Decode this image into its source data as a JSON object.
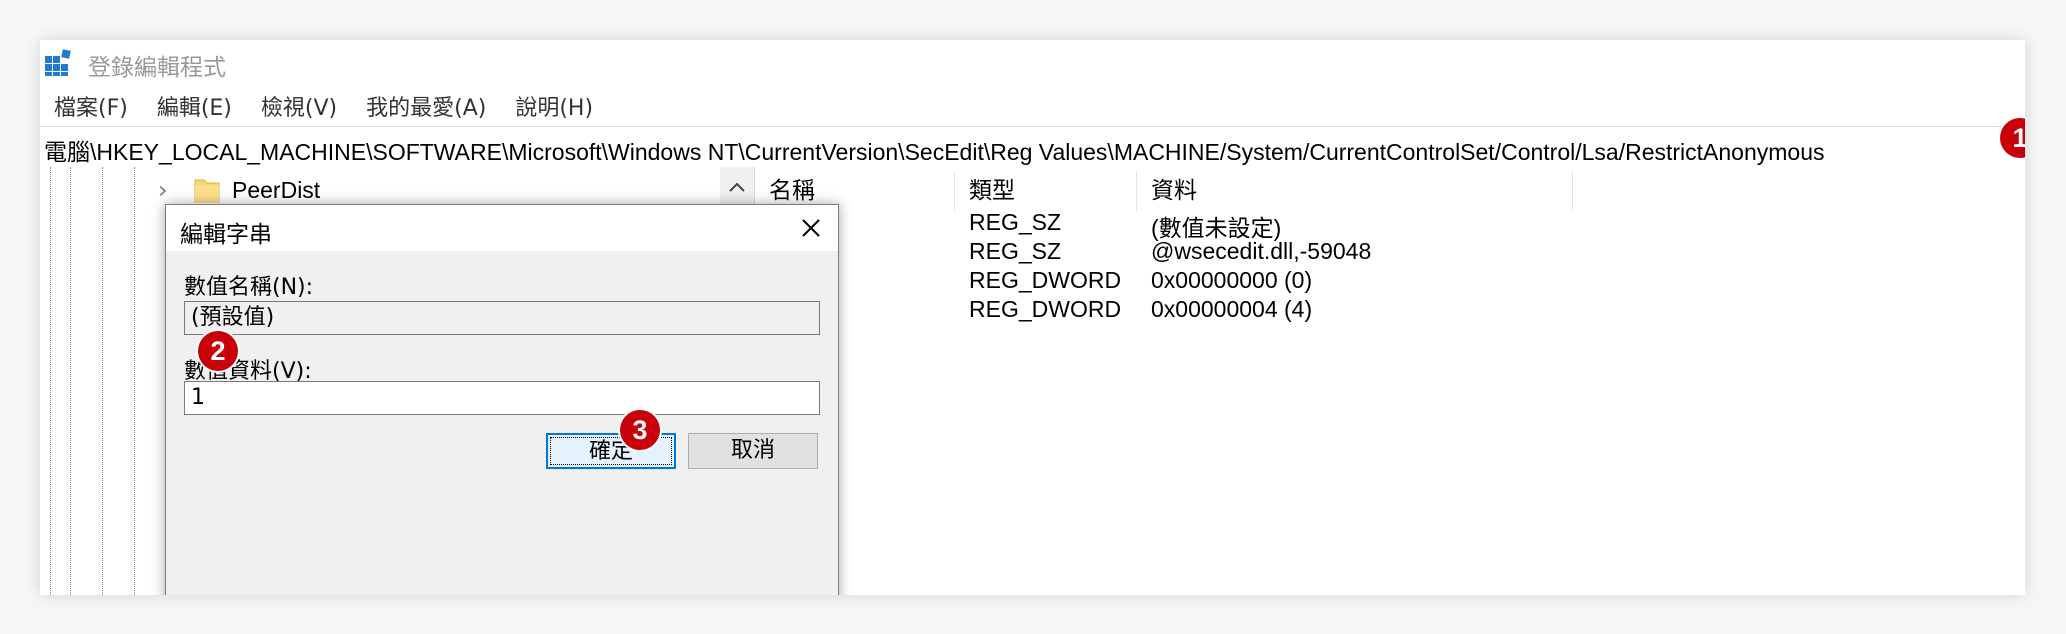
{
  "window": {
    "title": "登錄編輯程式",
    "icon": "registry-editor-icon"
  },
  "menu": [
    {
      "label": "檔案(F)"
    },
    {
      "label": "編輯(E)"
    },
    {
      "label": "檢視(V)"
    },
    {
      "label": "我的最愛(A)"
    },
    {
      "label": "說明(H)"
    }
  ],
  "address": {
    "path": "電腦\\HKEY_LOCAL_MACHINE\\SOFTWARE\\Microsoft\\Windows NT\\CurrentVersion\\SecEdit\\Reg Values\\MACHINE/System/CurrentControlSet/Control/Lsa/RestrictAnonymous"
  },
  "tree": {
    "items": [
      {
        "label": "PeerDist",
        "icon": "folder-icon",
        "expander": "chevron-right-icon"
      }
    ],
    "scroll_up_icon": "chevron-up-icon"
  },
  "values_table": {
    "columns": [
      "名稱",
      "類型",
      "資料"
    ],
    "rows": [
      {
        "type": "REG_SZ",
        "data": "(數值未設定)"
      },
      {
        "type": "REG_SZ",
        "data": "@wsecedit.dll,-59048"
      },
      {
        "type": "REG_DWORD",
        "data": "0x00000000 (0)"
      },
      {
        "type": "REG_DWORD",
        "data": "0x00000004 (4)"
      }
    ]
  },
  "dialog": {
    "title": "編輯字串",
    "close_icon": "close-icon",
    "name_label": "數值名稱(N):",
    "name_value": "(預設值)",
    "data_label": "數值資料(V):",
    "data_value": "1",
    "ok_label": "確定",
    "cancel_label": "取消"
  },
  "annotations": {
    "badge1": "1",
    "badge2": "2",
    "badge3": "3",
    "color": "#c8000a"
  },
  "colors": {
    "accent": "#0078d7",
    "folder": "#f8d775",
    "window_bg": "#ffffff",
    "dialog_bg": "#f0f0f0"
  }
}
